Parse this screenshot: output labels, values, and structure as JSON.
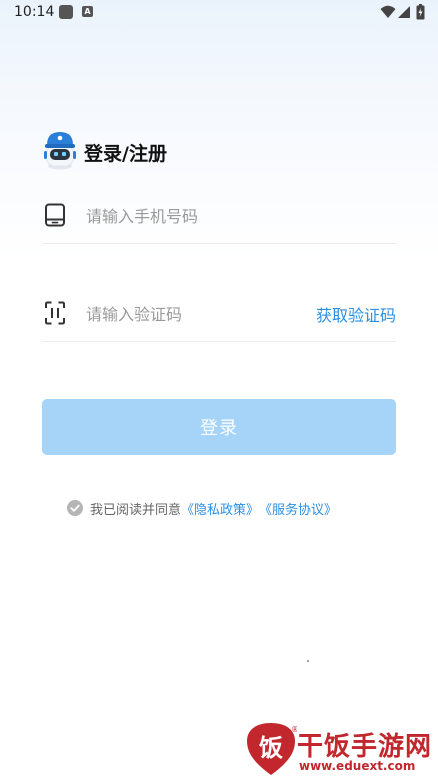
{
  "status_bar": {
    "time": "10:14",
    "notification_icon": "a-icon",
    "a_glyph": "A"
  },
  "brand": {
    "title": "登录/注册",
    "logo_icon": "robot-mascot-icon"
  },
  "phone_field": {
    "placeholder": "请输入手机号码",
    "value": "",
    "icon": "phone-icon"
  },
  "code_field": {
    "placeholder": "请输入验证码",
    "value": "",
    "icon": "scan-icon",
    "get_code_label": "获取验证码"
  },
  "login_button": {
    "label": "登录"
  },
  "agreement": {
    "prefix": "我已阅读并同意",
    "privacy_label": "《隐私政策》",
    "service_label": "《服务协议》"
  },
  "watermark": {
    "title": "干饭手游网",
    "url": "www.eduext.com",
    "logo_glyph": "饭",
    "trademark": "®"
  },
  "colors": {
    "accent": "#2d8fe0",
    "button_disabled": "#a5d4f8",
    "watermark": "#c1272d"
  }
}
